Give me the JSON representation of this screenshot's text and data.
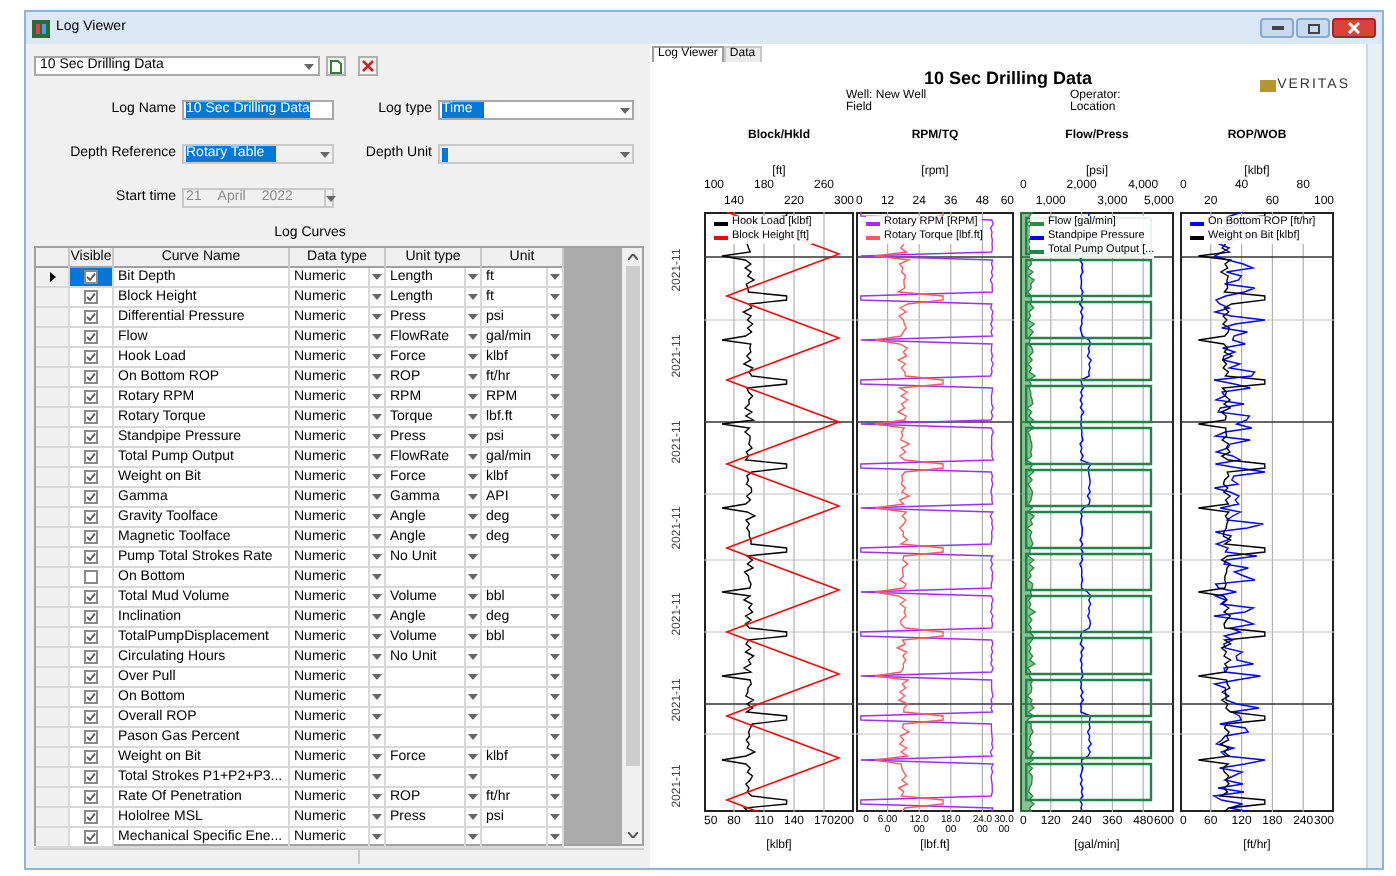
{
  "window": {
    "title": "Log Viewer"
  },
  "left": {
    "log_select": {
      "value": "10 Sec Drilling Data"
    },
    "log_name": {
      "label": "Log Name",
      "value": "10 Sec Drilling Data"
    },
    "log_type": {
      "label": "Log type",
      "value": "Time"
    },
    "depth_reference": {
      "label": "Depth Reference",
      "value": "Rotary Table",
      "disabled": true
    },
    "depth_unit": {
      "label": "Depth Unit",
      "disabled": true
    },
    "start_time": {
      "label": "Start time",
      "day": "21",
      "month": "April",
      "year": "2022",
      "disabled": true
    },
    "curves_title": "Log Curves",
    "table": {
      "columns": [
        "Visible",
        "Curve Name",
        "Data type",
        "Unit type",
        "Unit"
      ],
      "rows": [
        {
          "selected": true,
          "visible": true,
          "name": "Bit Depth",
          "data_type": "Numeric",
          "unit_type": "Length",
          "unit": "ft"
        },
        {
          "selected": false,
          "visible": true,
          "name": "Block Height",
          "data_type": "Numeric",
          "unit_type": "Length",
          "unit": "ft"
        },
        {
          "selected": false,
          "visible": true,
          "name": "Differential Pressure",
          "data_type": "Numeric",
          "unit_type": "Press",
          "unit": "psi"
        },
        {
          "selected": false,
          "visible": true,
          "name": "Flow",
          "data_type": "Numeric",
          "unit_type": "FlowRate",
          "unit": "gal/min"
        },
        {
          "selected": false,
          "visible": true,
          "name": "Hook Load",
          "data_type": "Numeric",
          "unit_type": "Force",
          "unit": "klbf"
        },
        {
          "selected": false,
          "visible": true,
          "name": "On Bottom ROP",
          "data_type": "Numeric",
          "unit_type": "ROP",
          "unit": "ft/hr"
        },
        {
          "selected": false,
          "visible": true,
          "name": "Rotary RPM",
          "data_type": "Numeric",
          "unit_type": "RPM",
          "unit": "RPM"
        },
        {
          "selected": false,
          "visible": true,
          "name": "Rotary Torque",
          "data_type": "Numeric",
          "unit_type": "Torque",
          "unit": "lbf.ft"
        },
        {
          "selected": false,
          "visible": true,
          "name": "Standpipe Pressure",
          "data_type": "Numeric",
          "unit_type": "Press",
          "unit": "psi"
        },
        {
          "selected": false,
          "visible": true,
          "name": "Total Pump Output",
          "data_type": "Numeric",
          "unit_type": "FlowRate",
          "unit": "gal/min"
        },
        {
          "selected": false,
          "visible": true,
          "name": "Weight on Bit",
          "data_type": "Numeric",
          "unit_type": "Force",
          "unit": "klbf"
        },
        {
          "selected": false,
          "visible": true,
          "name": "Gamma",
          "data_type": "Numeric",
          "unit_type": "Gamma",
          "unit": "API"
        },
        {
          "selected": false,
          "visible": true,
          "name": "Gravity Toolface",
          "data_type": "Numeric",
          "unit_type": "Angle",
          "unit": "deg"
        },
        {
          "selected": false,
          "visible": true,
          "name": "Magnetic Toolface",
          "data_type": "Numeric",
          "unit_type": "Angle",
          "unit": "deg"
        },
        {
          "selected": false,
          "visible": true,
          "name": "Pump Total Strokes Rate",
          "data_type": "Numeric",
          "unit_type": "No Unit"
        },
        {
          "selected": false,
          "visible": false,
          "name": "On Bottom",
          "data_type": "Numeric"
        },
        {
          "selected": false,
          "visible": true,
          "name": "Total Mud Volume",
          "data_type": "Numeric",
          "unit_type": "Volume",
          "unit": "bbl"
        },
        {
          "selected": false,
          "visible": true,
          "name": "Inclination",
          "data_type": "Numeric",
          "unit_type": "Angle",
          "unit": "deg"
        },
        {
          "selected": false,
          "visible": true,
          "name": "TotalPumpDisplacement",
          "data_type": "Numeric",
          "unit_type": "Volume",
          "unit": "bbl"
        },
        {
          "selected": false,
          "visible": true,
          "name": "Circulating Hours",
          "data_type": "Numeric",
          "unit_type": "No Unit"
        },
        {
          "selected": false,
          "visible": true,
          "name": "Over Pull",
          "data_type": "Numeric"
        },
        {
          "selected": false,
          "visible": true,
          "name": "On Bottom",
          "data_type": "Numeric"
        },
        {
          "selected": false,
          "visible": true,
          "name": "Overall ROP",
          "data_type": "Numeric"
        },
        {
          "selected": false,
          "visible": true,
          "name": "Pason Gas Percent",
          "data_type": "Numeric"
        },
        {
          "selected": false,
          "visible": true,
          "name": "Weight on Bit",
          "data_type": "Numeric",
          "unit_type": "Force",
          "unit": "klbf"
        },
        {
          "selected": false,
          "visible": true,
          "name": "Total Strokes P1+P2+P3...",
          "data_type": "Numeric"
        },
        {
          "selected": false,
          "visible": true,
          "name": "Rate Of Penetration",
          "data_type": "Numeric",
          "unit_type": "ROP",
          "unit": "ft/hr"
        },
        {
          "selected": false,
          "visible": true,
          "name": "Hololree MSL",
          "data_type": "Numeric",
          "unit_type": "Press",
          "unit": "psi"
        },
        {
          "selected": false,
          "visible": true,
          "name": "Mechanical Specific Ene...",
          "data_type": "Numeric"
        }
      ]
    }
  },
  "right": {
    "tabs": [
      {
        "label": "Log Viewer",
        "selected": true
      },
      {
        "label": "Data",
        "selected": false
      }
    ],
    "log": {
      "title": "10 Sec Drilling Data",
      "well": "Well: New Well",
      "field": "Field",
      "operator": "Operator:",
      "location": "Location",
      "logo": "VERITAS",
      "depth_labels": [
        "2021-11",
        "2021-11",
        "2021-11",
        "2021-11",
        "2021-11",
        "2021-11",
        "2021-11"
      ],
      "tracks": [
        {
          "title": "Block/Hkld",
          "unit": "[ft]",
          "upper_ticks": [
            "100",
            "180",
            "260"
          ],
          "lower_ticks": [
            "140",
            "220",
            "300"
          ],
          "bottom_ticks": [
            "50",
            "80",
            "110",
            "140",
            "170",
            "200"
          ],
          "bottom_unit": "[klbf]",
          "curves": [
            {
              "label": "Hook Load [klbf]",
              "color": "#000000",
              "kind": "trace"
            },
            {
              "label": "Block Height [ft]",
              "color": "#ff0000",
              "kind": "sawtooth"
            }
          ]
        },
        {
          "title": "RPM/TQ",
          "unit": "[rpm]",
          "lower_ticks": [
            "0",
            "12",
            "24",
            "36",
            "48",
            "60"
          ],
          "bottom_ticks": [
            "0",
            "6.000",
            "12.000",
            "18.000",
            "24.000",
            "30.000"
          ],
          "bottom_unit": "[lbf.ft]",
          "curves": [
            {
              "label": "Rotary RPM [RPM]",
              "color": "#9b30ff",
              "kind": "comb"
            },
            {
              "label": "Rotary Torque [lbf.ft]",
              "color": "#ff5a5a",
              "kind": "trace"
            }
          ]
        },
        {
          "title": "Flow/Press",
          "unit": "[psi]",
          "upper_ticks": [
            "0",
            "2,000",
            "4,000"
          ],
          "lower_ticks": [
            "1,000",
            "3,000",
            "5,000"
          ],
          "bottom_ticks": [
            "0",
            "120",
            "240",
            "360",
            "480",
            "600"
          ],
          "bottom_unit": "[gal/min]",
          "curves": [
            {
              "label": "Flow [gal/min]",
              "color": "#2e8b3e",
              "kind": "fill"
            },
            {
              "label": "Standpipe Pressure",
              "color": "#0000ff",
              "kind": "step"
            },
            {
              "label": "Total Pump Output [...",
              "color": "#1e8449",
              "kind": "frame"
            }
          ]
        },
        {
          "title": "ROP/WOB",
          "unit": "[klbf]",
          "upper_ticks": [
            "0",
            "40",
            "80"
          ],
          "lower_ticks": [
            "20",
            "60",
            "100"
          ],
          "bottom_ticks": [
            "0",
            "60",
            "120",
            "180",
            "240",
            "300"
          ],
          "bottom_unit": "[ft/hr]",
          "curves": [
            {
              "label": "On Bottom ROP [ft/hr]",
              "color": "#0000ff",
              "kind": "scatter"
            },
            {
              "label": "Weight on Bit [klbf]",
              "color": "#000000",
              "kind": "trace"
            }
          ]
        }
      ]
    }
  }
}
